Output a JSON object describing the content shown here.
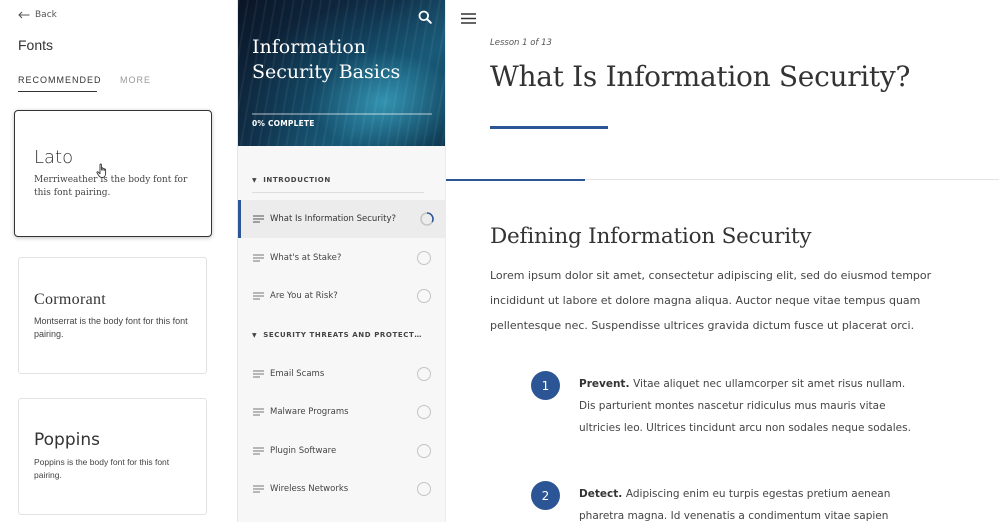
{
  "font_panel": {
    "back_label": "Back",
    "title": "Fonts",
    "tabs": {
      "recommended": "RECOMMENDED",
      "more": "MORE"
    },
    "cards": [
      {
        "name": "Lato",
        "description": "Merriweather is the body font for this font pairing."
      },
      {
        "name": "Cormorant",
        "description": "Montserrat is the body font for this font pairing."
      },
      {
        "name": "Poppins",
        "description": "Poppins is the body font for this font pairing."
      }
    ]
  },
  "course": {
    "title": "Information Security Basics",
    "progress_label": "0% COMPLETE",
    "progress_percent": 0,
    "sections": [
      {
        "title": "INTRODUCTION",
        "lessons": [
          {
            "label": "What Is Information Security?",
            "active": true
          },
          {
            "label": "What's at Stake?"
          },
          {
            "label": "Are You at Risk?"
          }
        ]
      },
      {
        "title": "SECURITY THREATS AND PROTECTION STRATEGIES",
        "lessons": [
          {
            "label": "Email Scams"
          },
          {
            "label": "Malware Programs"
          },
          {
            "label": "Plugin Software"
          },
          {
            "label": "Wireless Networks"
          }
        ]
      }
    ]
  },
  "lesson": {
    "counter": "Lesson 1 of 13",
    "title": "What Is Information Security?",
    "section_title": "Defining Information Security",
    "body": "Lorem ipsum dolor sit amet, consectetur adipiscing elit, sed do eiusmod tempor incididunt ut labore et dolore magna aliqua. Auctor neque vitae tempus quam pellentesque nec. Suspendisse ultrices gravida dictum fusce ut placerat orci.",
    "items": [
      {
        "number": "1",
        "heading": "Prevent.",
        "text": "Vitae aliquet nec ullamcorper sit amet risus nullam. Dis parturient montes nascetur ridiculus mus mauris vitae ultricies leo. Ultrices tincidunt arcu non sodales neque sodales."
      },
      {
        "number": "2",
        "heading": "Detect.",
        "text": "Adipiscing enim eu turpis egestas pretium aenean pharetra magna. Id venenatis a condimentum vitae sapien"
      }
    ]
  },
  "colors": {
    "accent": "#2c5596",
    "active_row_bg": "#ececec",
    "sidebar_bg": "#f7f7f7"
  },
  "icons": {
    "back": "arrow-left-icon",
    "search": "search-icon",
    "menu": "hamburger-menu-icon",
    "lesson": "text-lines-icon",
    "status": "status-circle-icon",
    "section_toggle": "triangle-down-icon",
    "pointer": "hand-pointer-cursor-icon"
  }
}
